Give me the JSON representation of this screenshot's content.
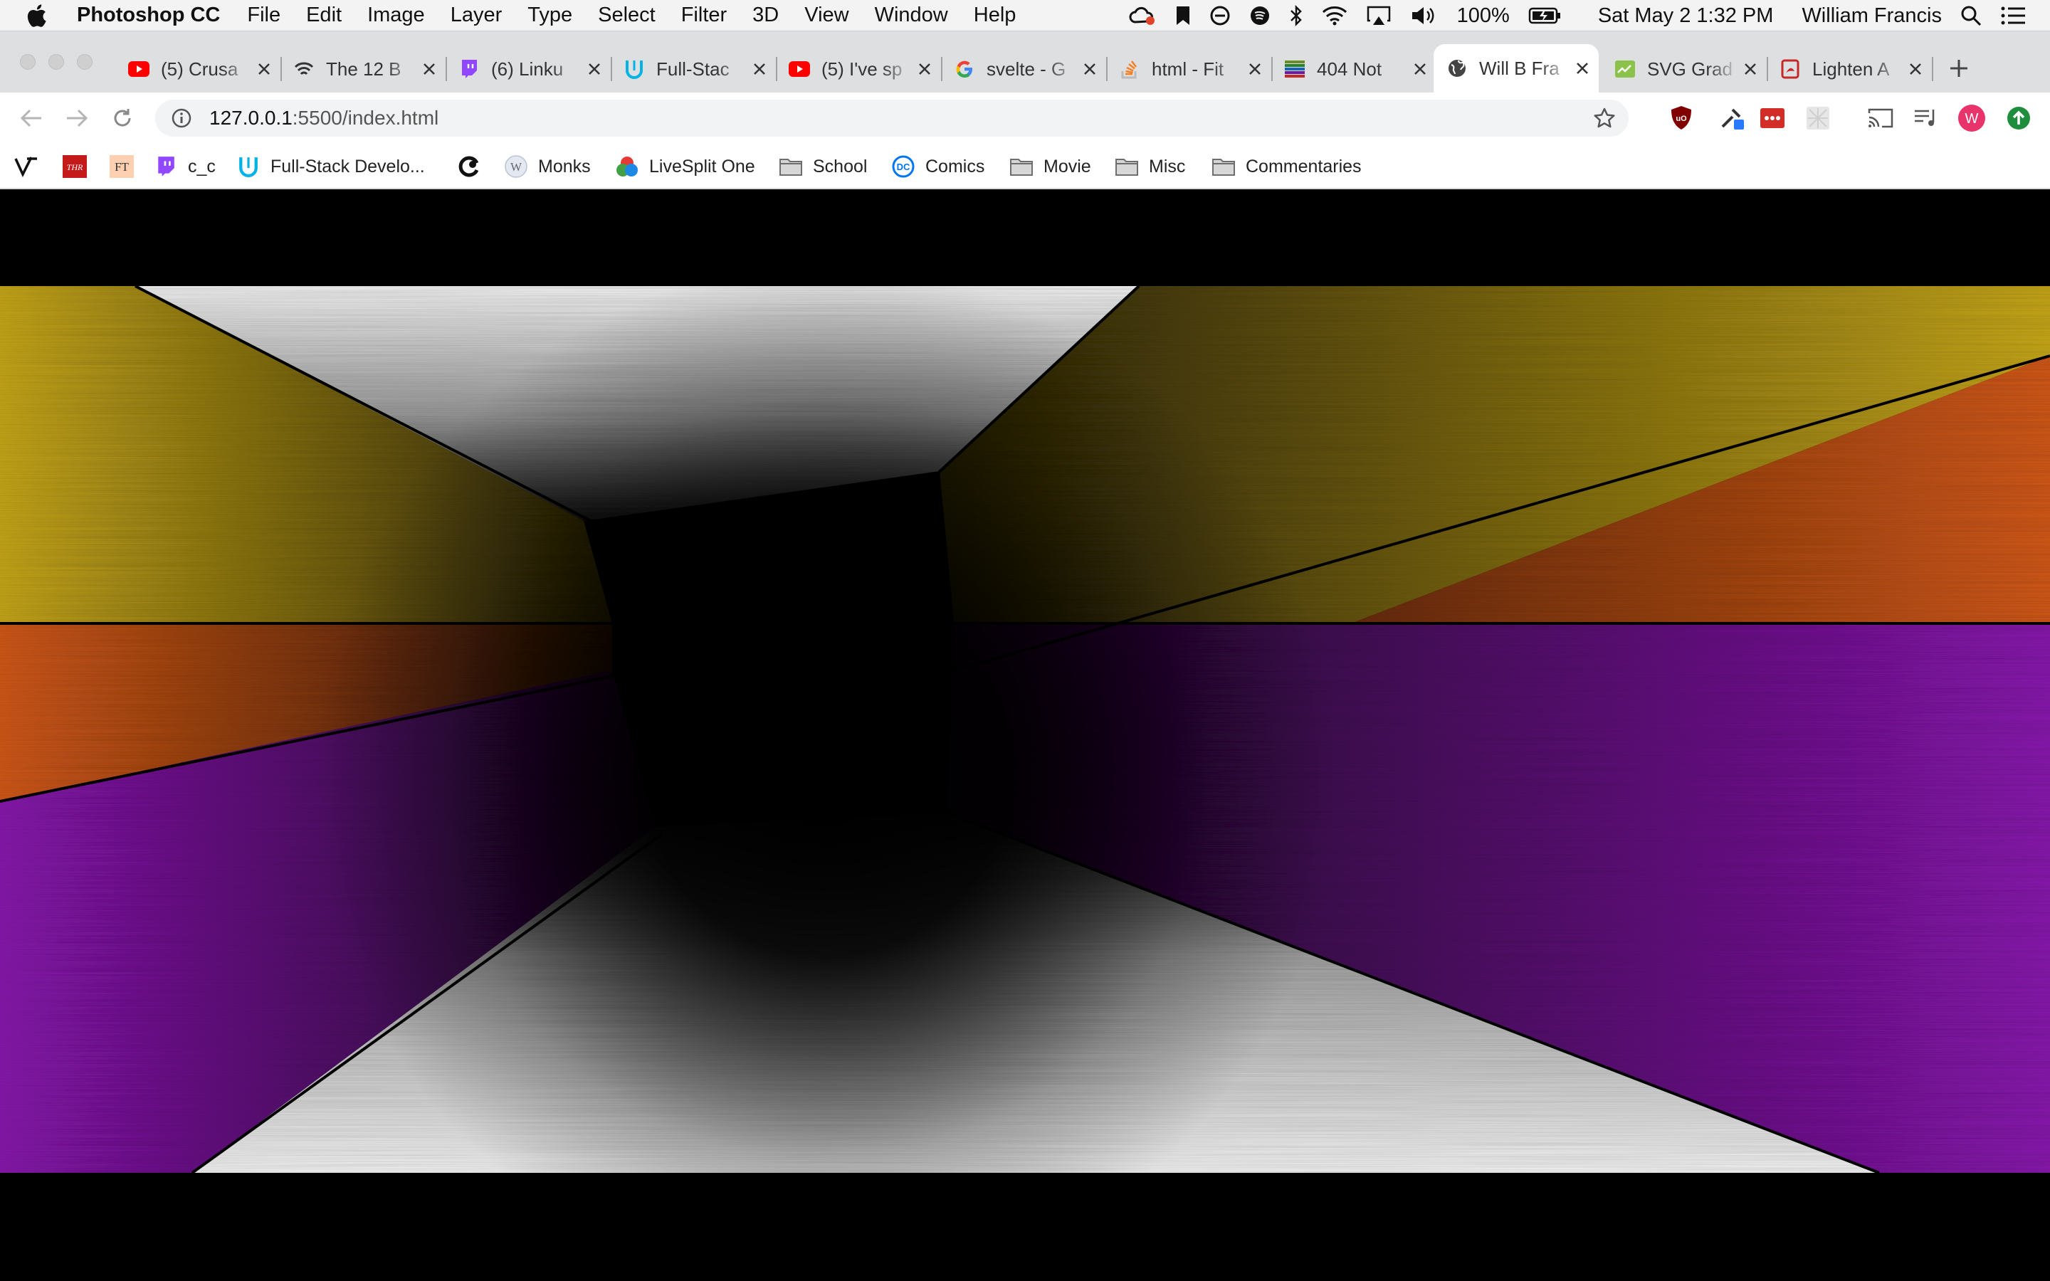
{
  "menubar": {
    "app_name": "Photoshop CC",
    "menus": [
      "File",
      "Edit",
      "Image",
      "Layer",
      "Type",
      "Select",
      "Filter",
      "3D",
      "View",
      "Window",
      "Help"
    ],
    "battery": "100%",
    "clock": "Sat May 2  1:32 PM",
    "user": "William Francis"
  },
  "tabs": [
    {
      "title": "(5) Crusa",
      "favicon": "youtube-icon",
      "color": "#ff0000"
    },
    {
      "title": "The 12 B",
      "favicon": "wifi-icon",
      "color": "#333333"
    },
    {
      "title": "(6) Linku",
      "favicon": "twitch-icon",
      "color": "#9146ff"
    },
    {
      "title": "Full-Stac",
      "favicon": "udacity-icon",
      "color": "#02b3e4"
    },
    {
      "title": "(5) I've sp",
      "favicon": "youtube-icon",
      "color": "#ff0000"
    },
    {
      "title": "svelte - G",
      "favicon": "google-icon",
      "color": "#4285f4"
    },
    {
      "title": "html - Fit",
      "favicon": "stackoverflow-icon",
      "color": "#f48024"
    },
    {
      "title": "404 Not",
      "favicon": "stripes-icon",
      "color": "#6b8e23"
    },
    {
      "title": "Will B Fra",
      "favicon": "globe-icon",
      "color": "#333333",
      "active": true
    },
    {
      "title": "SVG Grad",
      "favicon": "svg-gradient-icon",
      "color": "#8bc34a"
    },
    {
      "title": "Lighten A",
      "favicon": "pdf-icon",
      "color": "#c62828"
    }
  ],
  "address": {
    "host": "127.0.0.1",
    "path": ":5500/index.html"
  },
  "bookmarks": [
    {
      "label": "",
      "icon": "verge-icon"
    },
    {
      "label": "",
      "icon": "thr-icon"
    },
    {
      "label": "",
      "icon": "ft-icon"
    },
    {
      "label": "c_c",
      "icon": "twitch-icon"
    },
    {
      "label": "Full-Stack Develo...",
      "icon": "udacity-icon"
    },
    {
      "label": "",
      "icon": "crunchyroll-icon"
    },
    {
      "label": "Monks",
      "icon": "wiki-icon"
    },
    {
      "label": "LiveSplit One",
      "icon": "livesplit-icon"
    },
    {
      "label": "School",
      "icon": "folder-icon"
    },
    {
      "label": "Comics",
      "icon": "dc-icon"
    },
    {
      "label": "Movie",
      "icon": "folder-icon"
    },
    {
      "label": "Misc",
      "icon": "folder-icon"
    },
    {
      "label": "Commentaries",
      "icon": "folder-icon"
    }
  ],
  "scene": {
    "colors": {
      "yellow": "#c9a91a",
      "orange": "#d45a18",
      "purple": "#8a17b0",
      "silver": "#f2f2f2",
      "void": "#000000"
    }
  }
}
